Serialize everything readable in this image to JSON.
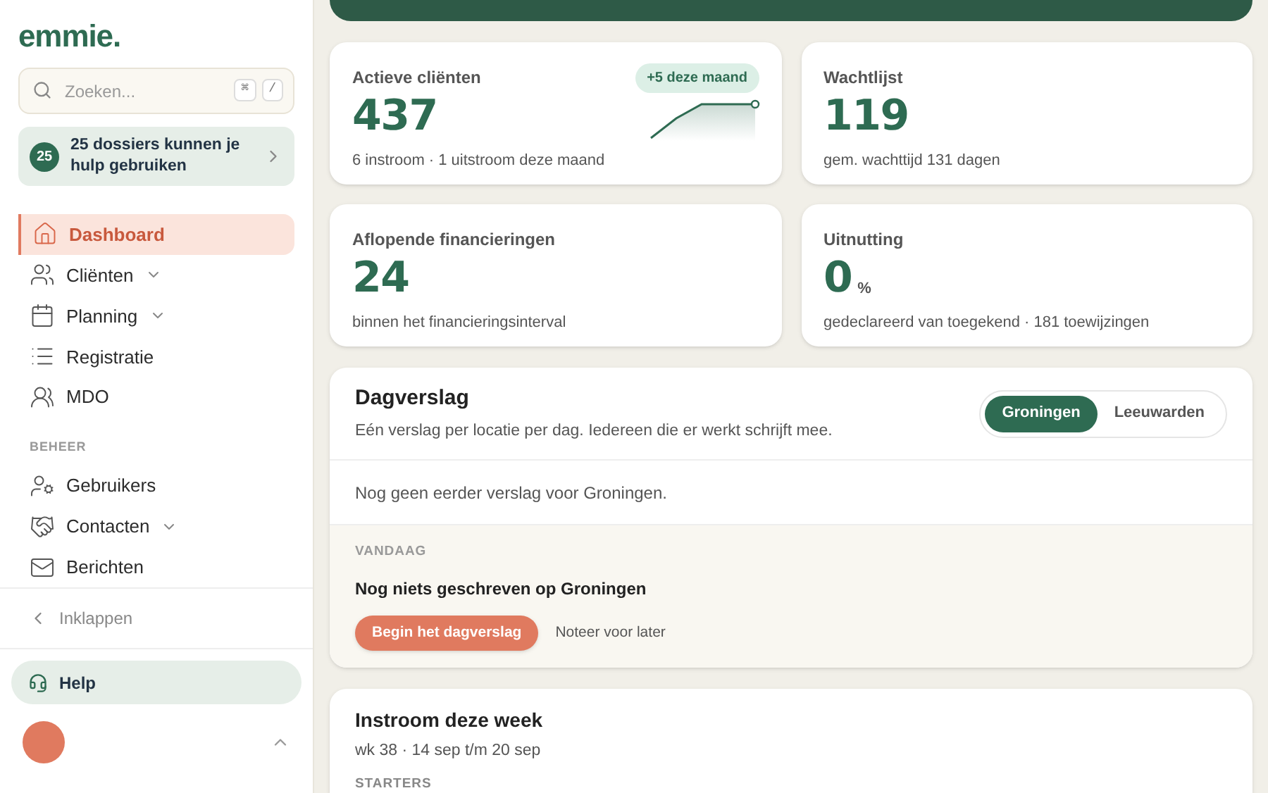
{
  "sidebar": {
    "logo": "emmie.",
    "search": {
      "placeholder": "Zoeken...",
      "keys": [
        "⌘",
        "/"
      ]
    },
    "alert": {
      "count": "25",
      "text": "25 dossiers kunnen je hulp gebruiken"
    },
    "items": [
      {
        "label": "Dashboard",
        "selected": true,
        "expandable": false
      },
      {
        "label": "Cliënten",
        "selected": false,
        "expandable": true
      },
      {
        "label": "Planning",
        "selected": false,
        "expandable": true
      },
      {
        "label": "Registratie",
        "selected": false,
        "expandable": false
      },
      {
        "label": "MDO",
        "selected": false,
        "expandable": false
      }
    ],
    "section": "BEHEER",
    "admin_items": [
      {
        "label": "Gebruikers",
        "selected": false,
        "expandable": false
      },
      {
        "label": "Contacten",
        "selected": false,
        "expandable": true
      },
      {
        "label": "Berichten",
        "selected": false,
        "expandable": false
      }
    ],
    "collapse": "Inklappen",
    "help": "Help"
  },
  "stats": [
    {
      "title": "Actieve cliënten",
      "value": "437",
      "badge": "+5 deze maand",
      "sub": "6 instroom · 1 uitstroom deze maand"
    },
    {
      "title": "Wachtlijst",
      "value": "119",
      "sub": "gem. wachttijd 131 dagen"
    },
    {
      "title": "Aflopende financieringen",
      "value": "24",
      "sub": "binnen het financieringsinterval"
    },
    {
      "title": "Uitnutting",
      "value": "0",
      "unit": "%",
      "sub": "gedeclareerd van toegekend · 181 toewijzingen"
    }
  ],
  "dagverslag": {
    "title": "Dagverslag",
    "subtitle": "Eén verslag per locatie per dag. Iedereen die er werkt schrijft mee.",
    "locations": [
      {
        "label": "Groningen",
        "selected": true
      },
      {
        "label": "Leeuwarden",
        "selected": false
      }
    ],
    "empty": "Nog geen eerder verslag voor Groningen.",
    "today_label": "VANDAAG",
    "today_text": "Nog niets geschreven op Groningen",
    "primary_button": "Begin het dagverslag",
    "secondary_button": "Noteer voor later"
  },
  "instroom": {
    "title": "Instroom deze week",
    "subtitle": "wk 38 · 14 sep t/m 20 sep",
    "section": "STARTERS"
  }
}
